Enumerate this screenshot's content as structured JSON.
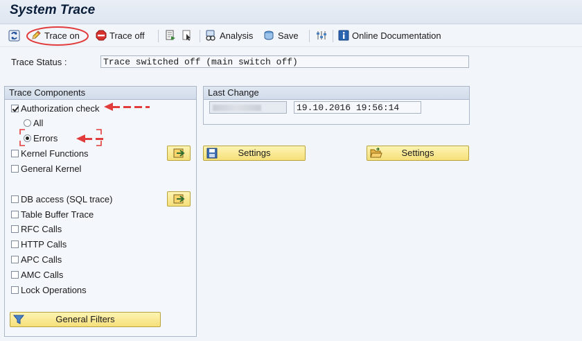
{
  "title": "System Trace",
  "toolbar": {
    "trace_on": "Trace on",
    "trace_off": "Trace off",
    "analysis": "Analysis",
    "save": "Save",
    "online_doc": "Online Documentation"
  },
  "status": {
    "label": "Trace Status :",
    "value": "Trace switched off (main switch off)"
  },
  "trace_components": {
    "header": "Trace Components",
    "authorization_check": {
      "label": "Authorization check",
      "checked": true
    },
    "auth_options": [
      {
        "label": "All",
        "selected": false
      },
      {
        "label": "Errors",
        "selected": true
      }
    ],
    "items": [
      {
        "label": "Kernel Functions",
        "checked": false
      },
      {
        "label": "General Kernel",
        "checked": false
      },
      {
        "label": "DB access (SQL trace)",
        "checked": false
      },
      {
        "label": "Table Buffer Trace",
        "checked": false
      },
      {
        "label": "RFC Calls",
        "checked": false
      },
      {
        "label": "HTTP Calls",
        "checked": false
      },
      {
        "label": "APC Calls",
        "checked": false
      },
      {
        "label": "AMC Calls",
        "checked": false
      },
      {
        "label": "Lock Operations",
        "checked": false
      }
    ],
    "general_filters": "General Filters"
  },
  "last_change": {
    "header": "Last Change",
    "timestamp": "19.10.2016 19:56:14"
  },
  "settings_buttons": [
    "Settings",
    "Settings"
  ],
  "colors": {
    "annotation": "#e23b3b",
    "button_yellow": "#f5e07a",
    "title_text": "#0b1f3b"
  }
}
